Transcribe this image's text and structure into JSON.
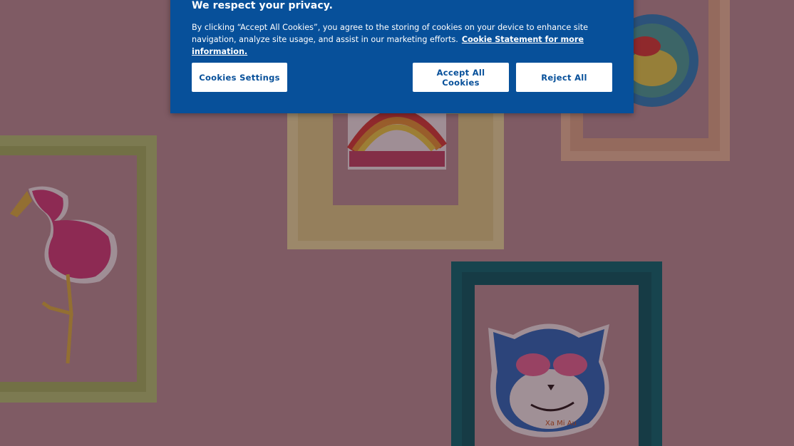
{
  "banner": {
    "title": "We respect your privacy.",
    "text": "By clicking “Accept All Cookies”, you agree to the storing of cookies on your device to enhance site navigation, analyze site usage, and assist in our marketing efforts.",
    "link_label": "Cookie Statement for more information."
  },
  "buttons": {
    "settings": "Cookies Settings",
    "accept": "Accept All Cookies",
    "reject": "Reject All"
  },
  "artwork": {
    "signature": "Xa Mi Au"
  },
  "colors": {
    "banner_bg": "#07509a",
    "button_bg": "#ffffff",
    "button_text": "#07509a",
    "wall": "#b58d92"
  }
}
